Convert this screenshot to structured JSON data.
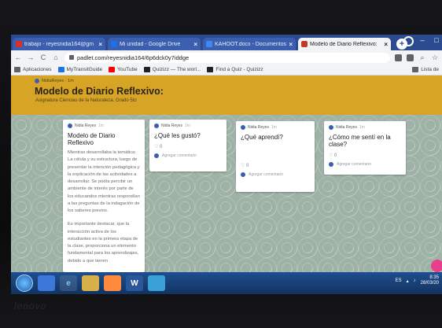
{
  "browser": {
    "tabs": [
      {
        "title": "trabajo - reyesnidia164@gm",
        "color": "#d93025",
        "active": false
      },
      {
        "title": "Mi unidad - Google Drive",
        "color": "#1a73e8",
        "active": false
      },
      {
        "title": "KAHOOT.docx - Documentos",
        "color": "#4285f4",
        "active": false
      },
      {
        "title": "Modelo de Diario Reflexivo:",
        "color": "#c0392b",
        "active": true
      }
    ],
    "url": "padlet.com/reyesnidia164/6p6dck0y7iddge",
    "bookmarks": [
      {
        "label": "Aplicaciones",
        "color": "#5f6368"
      },
      {
        "label": "MyTransitGuide",
        "color": "#1a73e8"
      },
      {
        "label": "YouTube",
        "color": "#ff0000"
      },
      {
        "label": "Quizizz — The worl...",
        "color": "#202124"
      },
      {
        "label": "Find a Quiz - Quizizz",
        "color": "#202124"
      }
    ],
    "reading_list": "Lista de"
  },
  "padlet": {
    "author": "NidiaReyes · 1m",
    "title": "Modelo de Diario Reflexivo:",
    "subtitle": "Asignatura Ciencias de la Naturaleza. Grado 5to",
    "cards": [
      {
        "author": "Nidia Reyes",
        "when": "1m",
        "title": "Modelo de Diario Reflexivo",
        "body": "Mientras desarrollaba la temática: La célula y su estructura, luego de presentar la intención pedagógica y la explicación de las actividades a desarrollar. Se podía percibir un ambiente de interés por parte de los educandos mientras respondían a las preguntas de la indagación de los saberes previos.",
        "body2": "Es importante destacar, que la interacción activa de los estudiantes en la primera etapa de la clase, proporciona un elemento fundamental para los aprendizajes, debido a que tienen"
      },
      {
        "author": "Nidia Reyes",
        "when": "1m",
        "title": "¿Qué les gustó?",
        "likes": "0",
        "comment": "Agregar comentario"
      },
      {
        "author": "Nidia Reyes",
        "when": "1m",
        "title": "¿Qué aprendí?",
        "likes": "0",
        "comment": "Agregar comentario"
      },
      {
        "author": "Nidia Reyes",
        "when": "1m",
        "title": "¿Cómo me sentí en la clase?",
        "likes": "0",
        "comment": "Agregar comentario"
      }
    ]
  },
  "taskbar": {
    "apps": [
      "IE",
      "Explorer",
      "Media",
      "Word",
      "Maps"
    ],
    "word_label": "W",
    "language": "ES",
    "time": "8:35",
    "date": "28/03/20"
  },
  "laptop_brand": "lenovo"
}
